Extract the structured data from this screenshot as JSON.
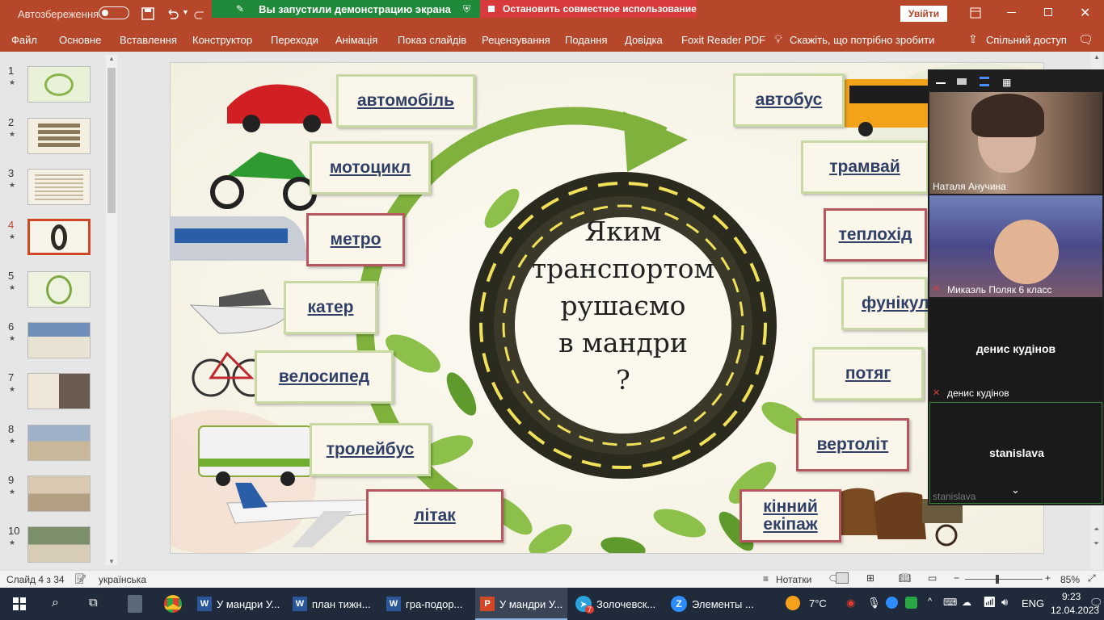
{
  "titlebar": {
    "autosave_label": "Автозбереження",
    "share_notice": "Вы запустили демонстрацию экрана",
    "stop_share": "Остановить совместное использование",
    "signin": "Увійти"
  },
  "ribbon": {
    "tabs": [
      "Файл",
      "Основне",
      "Вставлення",
      "Конструктор",
      "Переходи",
      "Анімація",
      "Показ слайдів",
      "Рецензування",
      "Подання",
      "Довідка",
      "Foxit Reader PDF"
    ],
    "tell_me": "Скажіть, що потрібно зробити",
    "share": "Спільний доступ"
  },
  "thumbnails": {
    "numbers": [
      "1",
      "2",
      "3",
      "4",
      "5",
      "6",
      "7",
      "8",
      "9",
      "10"
    ],
    "star": "★",
    "selected": "4"
  },
  "slide": {
    "title_lines": [
      "Яким",
      "транспортом",
      "рушаємо",
      "в мандри",
      "?"
    ],
    "left_labels": [
      "автомобіль",
      "мотоцикл",
      "метро",
      "катер",
      "велосипед",
      "тролейбус",
      "літак"
    ],
    "right_labels": [
      "автобус",
      "трамвай",
      "теплохід",
      "фунікул",
      "потяг",
      "вертоліт",
      "кінний",
      "екіпаж"
    ]
  },
  "video": {
    "participants": [
      "Наталя Анучина",
      "Микаэль Поляк 6 класс",
      "денис кудінов",
      "денис кудінов",
      "stanislava",
      "stanislava"
    ]
  },
  "statusbar": {
    "slide_info": "Слайд 4 з 34",
    "language": "українська",
    "notes": "Нотатки",
    "zoom": "85%"
  },
  "taskbar": {
    "apps": [
      "У мандри У...",
      "план тижн...",
      "гра-подор...",
      "У мандри У...",
      "Золочевск...",
      "Элементы ..."
    ],
    "telegram_badge": "7",
    "weather": "7°C",
    "lang": "ENG",
    "time": "9:23",
    "date": "12.04.2023"
  },
  "colors": {
    "ppt": "#b7472a",
    "share_green": "#1f8a3a",
    "share_red": "#d83b3b",
    "taskbar": "#1f2a3a"
  }
}
